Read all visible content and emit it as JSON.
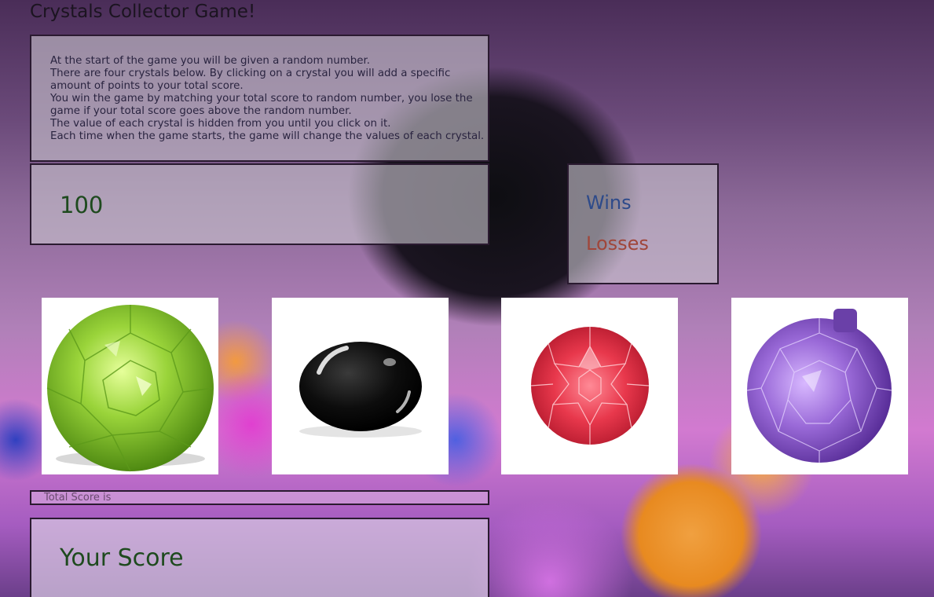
{
  "game": {
    "title": "Crystals Collector Game!",
    "instructions": [
      "At the start of the game you will be given a random number.",
      "There are four crystals below. By clicking on a crystal you will add a specific",
      "amount of points to your total score.",
      "You win the game by matching your total score to random number, you lose the",
      "game if your total score goes above the random number.",
      "The value of each crystal is hidden from you until you click on it.",
      "Each time when the game starts, the game will change the values of each crystal."
    ],
    "random_number": "100",
    "wins_label": "Wins",
    "losses_label": "Losses",
    "total_score_label": "Total Score is",
    "score_label": "Your Score"
  },
  "crystals": [
    {
      "name": "green-crystal",
      "color": "#8ccc30"
    },
    {
      "name": "black-crystal",
      "color": "#0a0a0a"
    },
    {
      "name": "red-crystal",
      "color": "#e0364a"
    },
    {
      "name": "purple-crystal",
      "color": "#8a5ac8"
    }
  ],
  "colors": {
    "score_text": "#1e4a1e",
    "wins_text": "#2d4a8a",
    "losses_text": "#a0463a"
  }
}
